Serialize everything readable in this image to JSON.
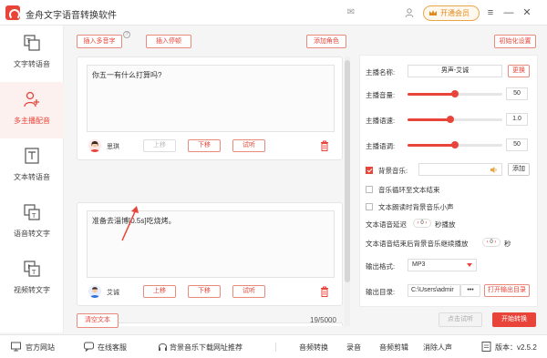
{
  "app": {
    "title": "金舟文字语音转换软件",
    "vip_label": "开通会员"
  },
  "sidebar": {
    "items": [
      {
        "label": "文字转语音",
        "active": false,
        "icon": "text-to-speech-icon"
      },
      {
        "label": "多主播配音",
        "active": true,
        "icon": "multi-anchor-icon"
      },
      {
        "label": "文本转语音",
        "active": false,
        "icon": "document-to-speech-icon"
      },
      {
        "label": "语音转文字",
        "active": false,
        "icon": "speech-to-text-icon"
      },
      {
        "label": "视频转文字",
        "active": false,
        "icon": "video-to-text-icon"
      }
    ]
  },
  "toolbar": {
    "insert_polyphone": "插入多音字",
    "help_mark": "?",
    "insert_pause": "插入停顿",
    "add_role": "添加角色",
    "init_settings": "初始化设置"
  },
  "cards": [
    {
      "text": "你五一有什么打算吗?",
      "speaker": "思琪",
      "up": "上移",
      "down": "下移",
      "listen": "试听",
      "up_disabled": true
    },
    {
      "text": "准备去淄博[0.5s]吃烧烤。",
      "speaker": "艾诚",
      "up": "上移",
      "down": "下移",
      "listen": "试听",
      "up_disabled": false
    }
  ],
  "footer_left": {
    "clear": "清空文本",
    "counter": "19/5000"
  },
  "settings": {
    "anchor_name_label": "主播名称:",
    "anchor_name_value": "男声-艾诚",
    "change_btn": "更换",
    "volume_label": "主播音量:",
    "volume_value": "50",
    "volume_level": 0.5,
    "speed_label": "主播语速:",
    "speed_value": "1.0",
    "speed_level": 0.45,
    "pitch_label": "主播语调:",
    "pitch_value": "50",
    "pitch_level": 0.5,
    "bgm_label": "背景音乐:",
    "bgm_checked": true,
    "add_btn": "添加",
    "loop_label": "音乐循环至文本结束",
    "lower_label": "文本朗读时背景音乐小声",
    "delay_label_pre": "文本语音延迟",
    "delay_value": "0",
    "delay_label_post": "秒播放",
    "continue_label_pre": "文本语音结束后背景音乐继续播放",
    "continue_value": "0",
    "continue_label_post": "秒",
    "format_label": "输出格式:",
    "format_value": "MP3",
    "dir_label": "输出目录:",
    "dir_value": "C:\\Users\\admir",
    "dir_more": "•••",
    "open_dir_btn": "打开输出目录"
  },
  "actions": {
    "preview": "点击试听",
    "start": "开始转换"
  },
  "bottombar": {
    "official_site": "官方网站",
    "online_service": "在线客服",
    "bgm_recommend": "背景音乐下载网址推荐",
    "audio_convert": "音频转换",
    "record": "录音",
    "audio_cut": "音频剪辑",
    "remove_voice": "消除人声",
    "version_label": "版本：",
    "version_value": "v2.5.2"
  },
  "colors": {
    "accent": "#e8443a",
    "accent_border": "#e98a7f",
    "vip": "#e08a1e"
  }
}
